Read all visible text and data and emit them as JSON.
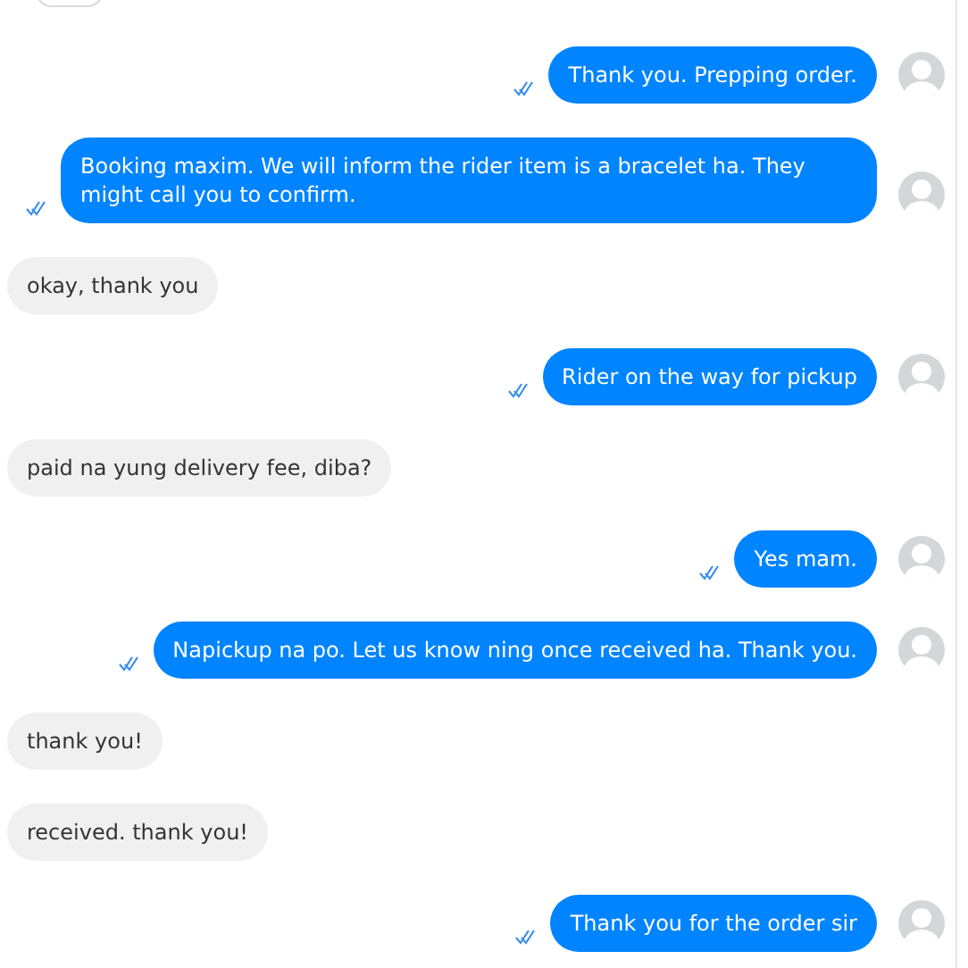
{
  "messages": [
    {
      "kind": "outgoing",
      "text": "Thank you. Prepping order.",
      "read": true
    },
    {
      "kind": "outgoing",
      "text": "Booking maxim. We will inform the rider item is a bracelet ha. They might call you to confirm.",
      "read": true
    },
    {
      "kind": "incoming",
      "text": "okay, thank you"
    },
    {
      "kind": "outgoing",
      "text": "Rider on the way for pickup",
      "read": true
    },
    {
      "kind": "incoming",
      "text": "paid na yung delivery fee, diba?"
    },
    {
      "kind": "outgoing",
      "text": "Yes mam.",
      "read": true
    },
    {
      "kind": "outgoing",
      "text": "Napickup na po. Let us know ning once received ha. Thank you.",
      "read": true
    },
    {
      "kind": "incoming",
      "text": "thank you!"
    },
    {
      "kind": "incoming",
      "text": "received. thank you!"
    },
    {
      "kind": "outgoing",
      "text": "Thank you for the order sir",
      "read": true
    }
  ]
}
